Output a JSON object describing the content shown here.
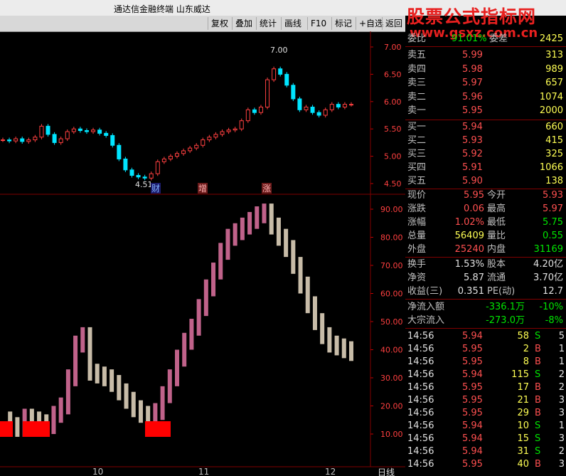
{
  "titlebar": {
    "title": "通达信金融终端  山东威达"
  },
  "toolbar": {
    "buttons": [
      "复权",
      "叠加",
      "统计",
      "画线",
      "F10",
      "标记",
      "+自选",
      "返回"
    ]
  },
  "watermark": {
    "line1": "股票公式指标网",
    "line2": "www.gsxz.com.cn"
  },
  "main_chart": {
    "y_ticks": [
      "7.00",
      "6.50",
      "6.00",
      "5.50",
      "5.00",
      "4.50"
    ],
    "high_label": "7.00",
    "low_label": "4.51",
    "markers": [
      "财",
      "增",
      "涨"
    ]
  },
  "sub_chart": {
    "y_ticks": [
      "90.00",
      "80.00",
      "70.00",
      "60.00",
      "50.00",
      "40.00",
      "30.00",
      "20.00",
      "10.00"
    ]
  },
  "x_axis": {
    "ticks": [
      "10",
      "11",
      "12"
    ],
    "period": "日线"
  },
  "quote": {
    "top_row": {
      "label": "委比",
      "value": "91.01%",
      "label2": "委差",
      "value2": "2425"
    },
    "asks": [
      {
        "label": "卖五",
        "price": "5.99",
        "vol": "313"
      },
      {
        "label": "卖四",
        "price": "5.98",
        "vol": "989"
      },
      {
        "label": "卖三",
        "price": "5.97",
        "vol": "657"
      },
      {
        "label": "卖二",
        "price": "5.96",
        "vol": "1074"
      },
      {
        "label": "卖一",
        "price": "5.95",
        "vol": "2000"
      }
    ],
    "bids": [
      {
        "label": "买一",
        "price": "5.94",
        "vol": "660"
      },
      {
        "label": "买二",
        "price": "5.93",
        "vol": "415"
      },
      {
        "label": "买三",
        "price": "5.92",
        "vol": "325"
      },
      {
        "label": "买四",
        "price": "5.91",
        "vol": "1066"
      },
      {
        "label": "买五",
        "price": "5.90",
        "vol": "138"
      }
    ],
    "stats": [
      {
        "l1": "现价",
        "v1": "5.95",
        "c1": "red",
        "l2": "今开",
        "v2": "5.93",
        "c2": "red"
      },
      {
        "l1": "涨跌",
        "v1": "0.06",
        "c1": "red",
        "l2": "最高",
        "v2": "5.97",
        "c2": "red"
      },
      {
        "l1": "涨幅",
        "v1": "1.02%",
        "c1": "red",
        "l2": "最低",
        "v2": "5.75",
        "c2": "grn"
      },
      {
        "l1": "总量",
        "v1": "56409",
        "c1": "yel",
        "l2": "量比",
        "v2": "0.55",
        "c2": "grn"
      },
      {
        "l1": "外盘",
        "v1": "25240",
        "c1": "red",
        "l2": "内盘",
        "v2": "31169",
        "c2": "grn"
      }
    ],
    "fund": [
      {
        "l1": "换手",
        "v1": "1.53%",
        "l2": "股本",
        "v2": "4.20亿"
      },
      {
        "l1": "净资",
        "v1": "5.87",
        "l2": "流通",
        "v2": "3.70亿"
      },
      {
        "l1": "收益(三)",
        "v1": "0.351",
        "l2": "PE(动)",
        "v2": "12.7"
      }
    ],
    "flow": [
      {
        "label": "净流入额",
        "value": "-336.1万",
        "pct": "-10%"
      },
      {
        "label": "大宗流入",
        "value": "-273.0万",
        "pct": "-8%"
      }
    ],
    "ticks": [
      {
        "time": "14:56",
        "price": "5.94",
        "vol": "58",
        "side": "S",
        "n": "5"
      },
      {
        "time": "14:56",
        "price": "5.95",
        "vol": "2",
        "side": "B",
        "n": "1"
      },
      {
        "time": "14:56",
        "price": "5.95",
        "vol": "8",
        "side": "B",
        "n": "1"
      },
      {
        "time": "14:56",
        "price": "5.94",
        "vol": "115",
        "side": "S",
        "n": "2"
      },
      {
        "time": "14:56",
        "price": "5.95",
        "vol": "17",
        "side": "B",
        "n": "2"
      },
      {
        "time": "14:56",
        "price": "5.95",
        "vol": "21",
        "side": "B",
        "n": "3"
      },
      {
        "time": "14:56",
        "price": "5.95",
        "vol": "29",
        "side": "B",
        "n": "3"
      },
      {
        "time": "14:56",
        "price": "5.94",
        "vol": "10",
        "side": "S",
        "n": "1"
      },
      {
        "time": "14:56",
        "price": "5.94",
        "vol": "15",
        "side": "S",
        "n": "3"
      },
      {
        "time": "14:56",
        "price": "5.94",
        "vol": "31",
        "side": "S",
        "n": "2"
      },
      {
        "time": "14:56",
        "price": "5.95",
        "vol": "40",
        "side": "B",
        "n": "3"
      }
    ]
  },
  "colors": {
    "up": "#ff4040",
    "down": "#00e5ff",
    "osc_up": "#c0628a",
    "osc_down": "#c8bca8",
    "grid": "#800000"
  }
}
